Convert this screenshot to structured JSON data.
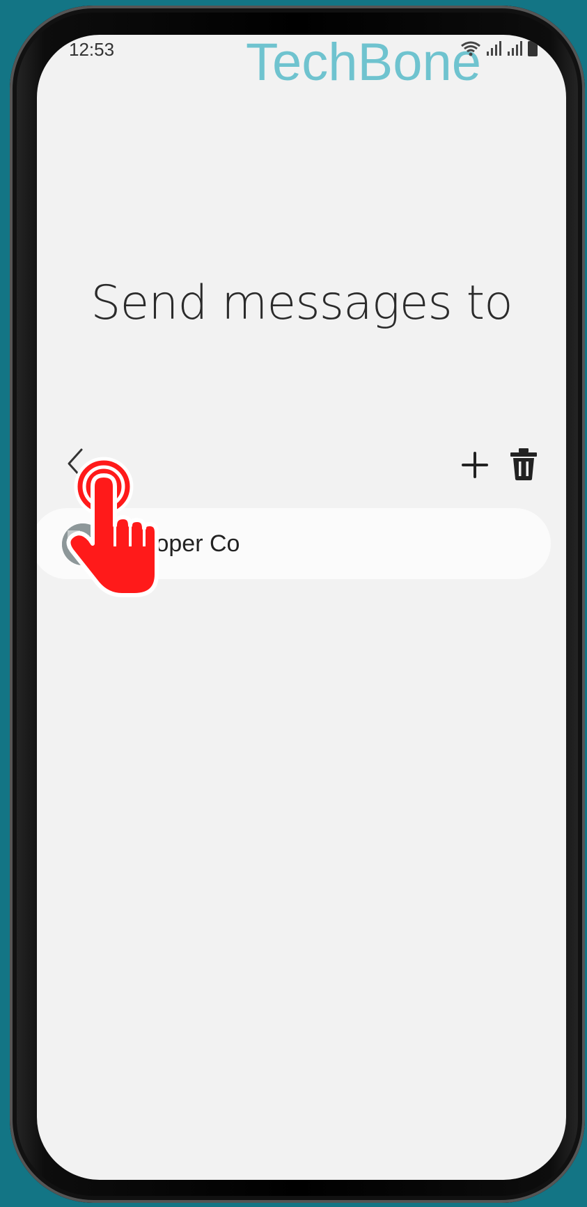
{
  "status_bar": {
    "time": "12:53",
    "icons": [
      "wifi-icon",
      "signal-icon",
      "signal-icon",
      "battery-icon"
    ]
  },
  "watermark": "TechBone",
  "page": {
    "title": "Send messages to"
  },
  "toolbar": {
    "back_icon": "chevron-left-icon",
    "add_icon": "plus-icon",
    "delete_icon": "trash-icon"
  },
  "contacts": [
    {
      "name": "Cooper Co"
    }
  ],
  "colors": {
    "background": "#137585",
    "screen": "#f2f2f2",
    "watermark": "#6fc3cf",
    "tap_indicator": "#ff1a1a"
  }
}
